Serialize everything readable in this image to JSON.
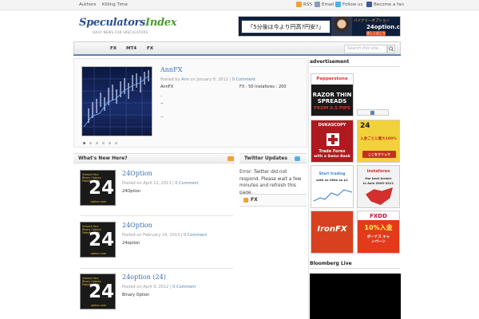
{
  "topbar": {
    "nav": [
      "Authors",
      "Killing Time"
    ],
    "social": [
      {
        "label": "RSS",
        "icon": "rss-icon",
        "color": "#f2a03a"
      },
      {
        "label": "Email",
        "icon": "mail-icon",
        "color": "#8aa0b8"
      },
      {
        "label": "Follow us",
        "icon": "twitter-icon",
        "color": "#4ab3e6"
      },
      {
        "label": "Become a fan",
        "icon": "facebook-icon",
        "color": "#3b5998"
      }
    ]
  },
  "header": {
    "logo_part1": "Speculators",
    "logo_part2": "Index",
    "tagline": "DAILY NEWS FOR SPECULATORS",
    "banner": {
      "jp_text": "「5分後は今より円高?円安?」",
      "bo_text": "バイナリーオプション",
      "logo_text": "24option.com",
      "cta_text": "詳しくはこちら"
    }
  },
  "nav": {
    "items": [
      "FX",
      "MT4",
      "FX"
    ],
    "search_placeholder": "Search this site..."
  },
  "featured": {
    "title": "AnnFX",
    "meta_prefix": "Posted by",
    "author": "Ann",
    "date_prefix": "on",
    "date": "January 8, 2012",
    "comment_sep": "|",
    "comments": "0 Comment",
    "col1": "AnnFX",
    "col2": "FX : 50 Instaforex : 200",
    "lines": [
      "-",
      "--",
      "--"
    ],
    "slide_count": 6
  },
  "whats_new": {
    "heading": "What's New Here?",
    "posts": [
      {
        "title": "24Option",
        "date": "April 12, 2013",
        "comments": "0 Comment",
        "text": "24Option"
      },
      {
        "title": "24Option",
        "date": "February 14, 2013",
        "comments": "0 Comment",
        "text": "24option"
      },
      {
        "title": "24option (24)",
        "date": "April 9, 2012",
        "comments": "0 Comment",
        "text": "Binary Option"
      }
    ],
    "meta_prefix": "Posted on",
    "comment_sep": "|",
    "thumb": {
      "top_text": "Unleash Your\nBinary Options\nPotential With",
      "big": "24",
      "sub": "option.com"
    }
  },
  "twitter": {
    "heading": "Twitter Updates",
    "error_text": "Error: Twitter did not respond. Please wait a few minutes and refresh this page."
  },
  "fx_widget": {
    "heading": "FX"
  },
  "sidebar": {
    "ad_heading": "advertisement",
    "bloomberg_heading": "Bloomberg Live",
    "ads": [
      {
        "name": "pepperstone-ad",
        "line1": "Pepperstone",
        "line2": "RAZOR THIN SPREADS",
        "line3": "FROM 0.5 PIPS",
        "bg": "#1a1a1a",
        "accent": "#d9332b"
      },
      {
        "name": "dukascopy-ad",
        "line1": "DUKASCOPY",
        "line2": "Trade Forex",
        "line3": "with a Swiss Bank",
        "bg": "#b0191e",
        "accent": "#ffffff"
      },
      {
        "name": "24option-side-ad",
        "line1": "24",
        "line2": "入金ごとに最大100%",
        "line3": "ここをクリック",
        "bg": "#f1d23a",
        "accent": "#1a1a1a"
      },
      {
        "name": "start-trading-ad",
        "line1": "Start trading",
        "line2": "with as little as $1",
        "line3": "",
        "bg": "#ffffff",
        "accent": "#2a7bc8"
      },
      {
        "name": "instaforex-ad",
        "line1": "instaforex",
        "line2": "the best broker",
        "line3": "in Asia 2009-2011",
        "bg": "#f2f2f2",
        "accent": "#d32f2f"
      },
      {
        "name": "ironfx-ad",
        "line1": "IronFX",
        "line2": "",
        "line3": "",
        "bg": "#d8411f",
        "accent": "#ffffff"
      },
      {
        "name": "fxdd-ad",
        "line1": "FXDD",
        "line2": "10%入金",
        "line3": "ボーナス キャンペーン",
        "bg": "#e23a1a",
        "accent": "#fff35a"
      }
    ]
  }
}
